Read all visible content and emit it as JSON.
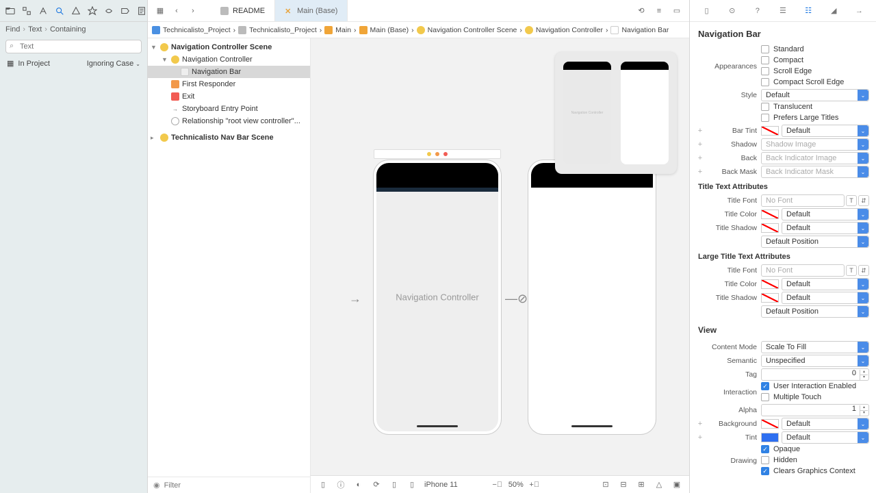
{
  "sidebar": {
    "find_breadcrumb": [
      "Find",
      "Text",
      "Containing"
    ],
    "search_placeholder": "Text",
    "scope_label": "In Project",
    "ignoring_label": "Ignoring Case"
  },
  "tabs": {
    "t1": "README",
    "t2": "Main (Base)"
  },
  "breadcrumb": {
    "b1": "Technicalisto_Project",
    "b2": "Technicalisto_Project",
    "b3": "Main",
    "b4": "Main (Base)",
    "b5": "Navigation Controller Scene",
    "b6": "Navigation Controller",
    "b7": "Navigation Bar"
  },
  "outline": {
    "scene1": "Navigation Controller Scene",
    "vc": "Navigation Controller",
    "navbar": "Navigation Bar",
    "first": "First Responder",
    "exit": "Exit",
    "entry": "Storyboard Entry Point",
    "rel": "Relationship \"root view controller\"...",
    "scene2": "Technicalisto Nav Bar Scene",
    "filter_placeholder": "Filter"
  },
  "canvas": {
    "nav_label": "Navigation Controller",
    "mini_label": "Navigation Controller",
    "device": "iPhone 11",
    "zoom": "50%"
  },
  "inspector": {
    "title": "Navigation Bar",
    "appearances_label": "Appearances",
    "app_standard": "Standard",
    "app_compact": "Compact",
    "app_scroll": "Scroll Edge",
    "app_compact_scroll": "Compact Scroll Edge",
    "style_label": "Style",
    "style_value": "Default",
    "translucent": "Translucent",
    "prefers_large": "Prefers Large Titles",
    "bar_tint_label": "Bar Tint",
    "bar_tint_value": "Default",
    "shadow_label": "Shadow",
    "shadow_ph": "Shadow Image",
    "back_label": "Back",
    "back_ph": "Back Indicator Image",
    "back_mask_label": "Back Mask",
    "back_mask_ph": "Back Indicator Mask",
    "title_attrs": "Title Text Attributes",
    "title_font_label": "Title Font",
    "no_font": "No Font",
    "title_color_label": "Title Color",
    "title_shadow_label": "Title Shadow",
    "default": "Default",
    "default_position": "Default Position",
    "large_title_attrs": "Large Title Text Attributes",
    "view_title": "View",
    "content_mode_label": "Content Mode",
    "content_mode_value": "Scale To Fill",
    "semantic_label": "Semantic",
    "semantic_value": "Unspecified",
    "tag_label": "Tag",
    "tag_value": "0",
    "interaction_label": "Interaction",
    "user_interaction": "User Interaction Enabled",
    "multiple_touch": "Multiple Touch",
    "alpha_label": "Alpha",
    "alpha_value": "1",
    "background_label": "Background",
    "tint_label": "Tint",
    "drawing_label": "Drawing",
    "opaque": "Opaque",
    "hidden": "Hidden",
    "clears_graphics": "Clears Graphics Context"
  }
}
